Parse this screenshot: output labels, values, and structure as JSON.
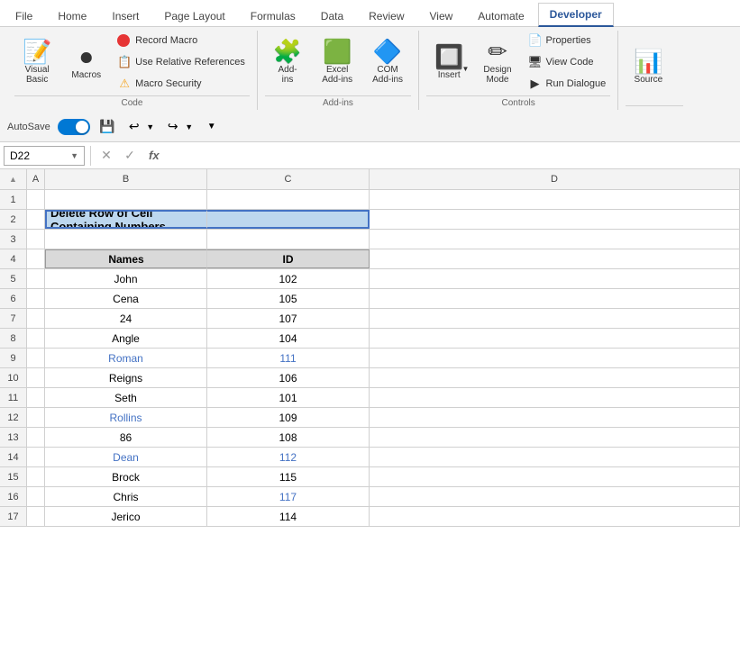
{
  "tabs": [
    {
      "label": "File",
      "active": false
    },
    {
      "label": "Home",
      "active": false
    },
    {
      "label": "Insert",
      "active": false
    },
    {
      "label": "Page Layout",
      "active": false
    },
    {
      "label": "Formulas",
      "active": false
    },
    {
      "label": "Data",
      "active": false
    },
    {
      "label": "Review",
      "active": false
    },
    {
      "label": "View",
      "active": false
    },
    {
      "label": "Automate",
      "active": false
    },
    {
      "label": "Developer",
      "active": true
    }
  ],
  "ribbon": {
    "code_group": {
      "label": "Code",
      "visual_basic_label": "Visual\nBasic",
      "macros_label": "Macros",
      "record_macro_label": "Record Macro",
      "relative_refs_label": "Use Relative References",
      "macro_security_label": "Macro Security"
    },
    "addins_group": {
      "label": "Add-ins",
      "add_ins_label": "Add-\nins",
      "excel_addins_label": "Excel\nAdd-ins",
      "com_addins_label": "COM\nAdd-ins"
    },
    "controls_group": {
      "label": "Controls",
      "insert_label": "Insert",
      "design_mode_label": "Design\nMode",
      "properties_label": "Properties",
      "view_code_label": "View Code",
      "run_dialogue_label": "Run Dialogue"
    },
    "source_group": {
      "label": "",
      "source_label": "Source"
    }
  },
  "autosave": {
    "label": "AutoSave",
    "on": true
  },
  "cell_ref": "D22",
  "formula_bar_value": "",
  "title_cell": "Delete Row of Cell Containing Numbers",
  "columns": [
    "A",
    "B",
    "C",
    "D"
  ],
  "col_headers": [
    "A",
    "B",
    "C",
    "D"
  ],
  "table_headers": [
    "Names",
    "ID"
  ],
  "rows": [
    {
      "num": 1,
      "b": "",
      "c": ""
    },
    {
      "num": 2,
      "b": "Delete Row of Cell Containing Numbers",
      "c": "",
      "title": true
    },
    {
      "num": 3,
      "b": "",
      "c": ""
    },
    {
      "num": 4,
      "b": "Names",
      "c": "ID",
      "header": true
    },
    {
      "num": 5,
      "b": "John",
      "c": "102",
      "b_blue": false,
      "c_blue": false
    },
    {
      "num": 6,
      "b": "Cena",
      "c": "105",
      "b_blue": false,
      "c_blue": false
    },
    {
      "num": 7,
      "b": "24",
      "c": "107",
      "b_blue": false,
      "c_blue": false
    },
    {
      "num": 8,
      "b": "Angle",
      "c": "104",
      "b_blue": false,
      "c_blue": false
    },
    {
      "num": 9,
      "b": "Roman",
      "c": "111",
      "b_blue": true,
      "c_blue": true
    },
    {
      "num": 10,
      "b": "Reigns",
      "c": "106",
      "b_blue": false,
      "c_blue": false
    },
    {
      "num": 11,
      "b": "Seth",
      "c": "101",
      "b_blue": false,
      "c_blue": false
    },
    {
      "num": 12,
      "b": "Rollins",
      "c": "109",
      "b_blue": true,
      "c_blue": false
    },
    {
      "num": 13,
      "b": "86",
      "c": "108",
      "b_blue": false,
      "c_blue": false
    },
    {
      "num": 14,
      "b": "Dean",
      "c": "112",
      "b_blue": true,
      "c_blue": true
    },
    {
      "num": 15,
      "b": "Brock",
      "c": "115",
      "b_blue": false,
      "c_blue": false
    },
    {
      "num": 16,
      "b": "Chris",
      "c": "117",
      "b_blue": false,
      "c_blue": true
    },
    {
      "num": 17,
      "b": "Jerico",
      "c": "114",
      "b_blue": false,
      "c_blue": false
    }
  ]
}
